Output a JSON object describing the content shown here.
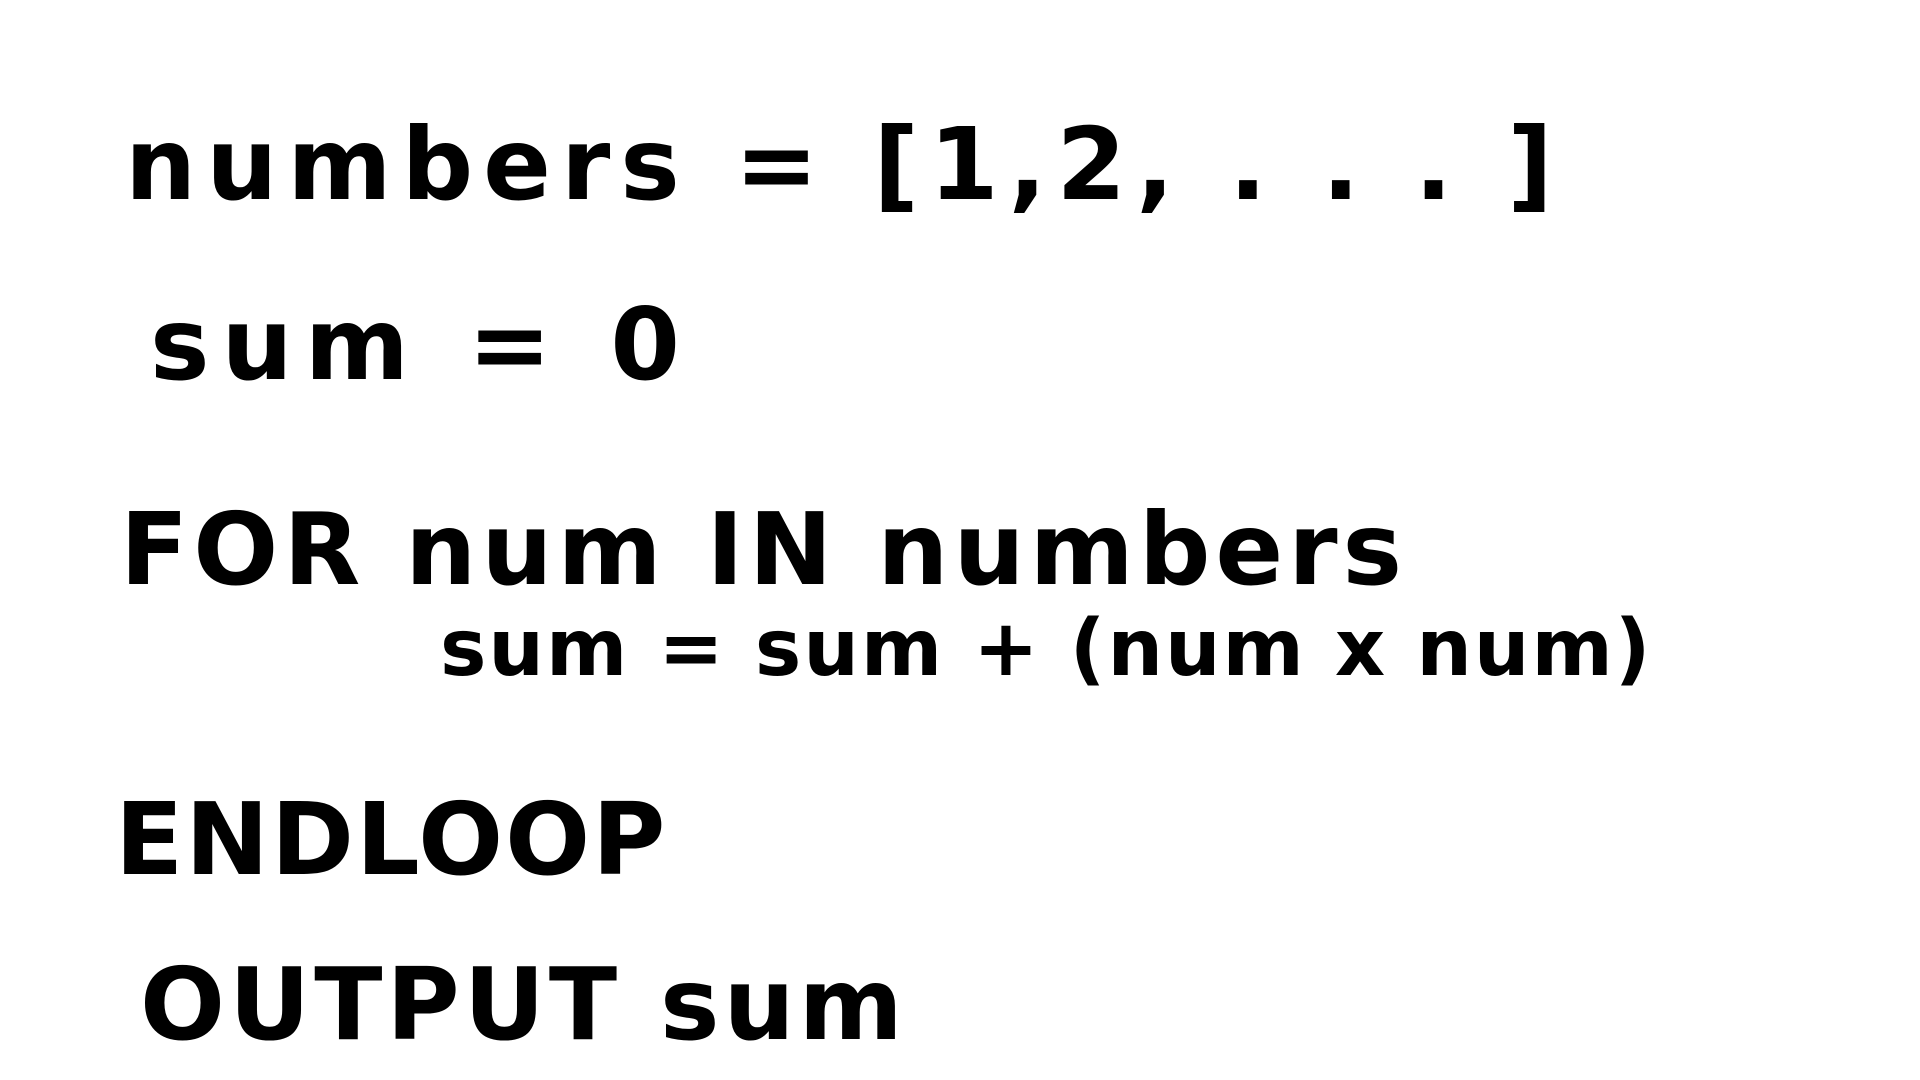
{
  "document": {
    "lines": [
      "numbers = [1,2, . . . ]",
      "sum = 0",
      "FOR num IN numbers",
      "sum = sum + (num x num)",
      "ENDLOOP",
      "OUTPUT sum"
    ]
  },
  "colors": {
    "ink": "#000000",
    "background": "#ffffff"
  }
}
